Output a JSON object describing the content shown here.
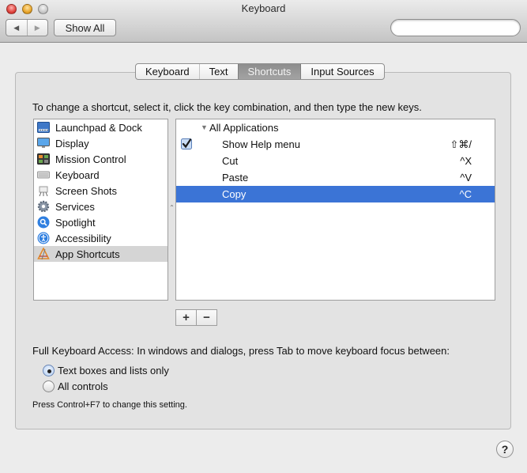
{
  "window": {
    "title": "Keyboard",
    "back_label": "◀",
    "forward_label": "▶",
    "show_all_label": "Show All",
    "search_placeholder": "",
    "search_value": ""
  },
  "tabs": [
    {
      "label": "Keyboard",
      "active": false
    },
    {
      "label": "Text",
      "active": false
    },
    {
      "label": "Shortcuts",
      "active": true
    },
    {
      "label": "Input Sources",
      "active": false
    }
  ],
  "instructions": "To change a shortcut, select it, click the key combination, and then type the new keys.",
  "categories": [
    {
      "label": "Launchpad & Dock",
      "icon": "launchpad-dock-icon",
      "selected": false
    },
    {
      "label": "Display",
      "icon": "display-icon",
      "selected": false
    },
    {
      "label": "Mission Control",
      "icon": "mission-control-icon",
      "selected": false
    },
    {
      "label": "Keyboard",
      "icon": "keyboard-icon",
      "selected": false
    },
    {
      "label": "Screen Shots",
      "icon": "screen-shots-icon",
      "selected": false
    },
    {
      "label": "Services",
      "icon": "gear-icon",
      "selected": false
    },
    {
      "label": "Spotlight",
      "icon": "spotlight-icon",
      "selected": false
    },
    {
      "label": "Accessibility",
      "icon": "accessibility-icon",
      "selected": false
    },
    {
      "label": "App Shortcuts",
      "icon": "app-shortcuts-icon",
      "selected": true
    }
  ],
  "shortcuts": {
    "group_label": "All Applications",
    "items": [
      {
        "name": "Show Help menu",
        "key": "⇧⌘/",
        "checked": true,
        "has_checkbox": true,
        "selected": false
      },
      {
        "name": "Cut",
        "key": "^X",
        "checked": false,
        "has_checkbox": false,
        "selected": false
      },
      {
        "name": "Paste",
        "key": "^V",
        "checked": false,
        "has_checkbox": false,
        "selected": false
      },
      {
        "name": "Copy",
        "key": "^C",
        "checked": false,
        "has_checkbox": false,
        "selected": true
      }
    ]
  },
  "buttons": {
    "add_label": "+",
    "remove_label": "−",
    "help_label": "?"
  },
  "full_keyboard_access": {
    "label": "Full Keyboard Access: In windows and dialogs, press Tab to move keyboard focus between:",
    "options": [
      {
        "label": "Text boxes and lists only",
        "selected": true
      },
      {
        "label": "All controls",
        "selected": false
      }
    ],
    "hint": "Press Control+F7 to change this setting."
  },
  "colors": {
    "selection": "#3b74d6",
    "active_tab": "#969696"
  }
}
